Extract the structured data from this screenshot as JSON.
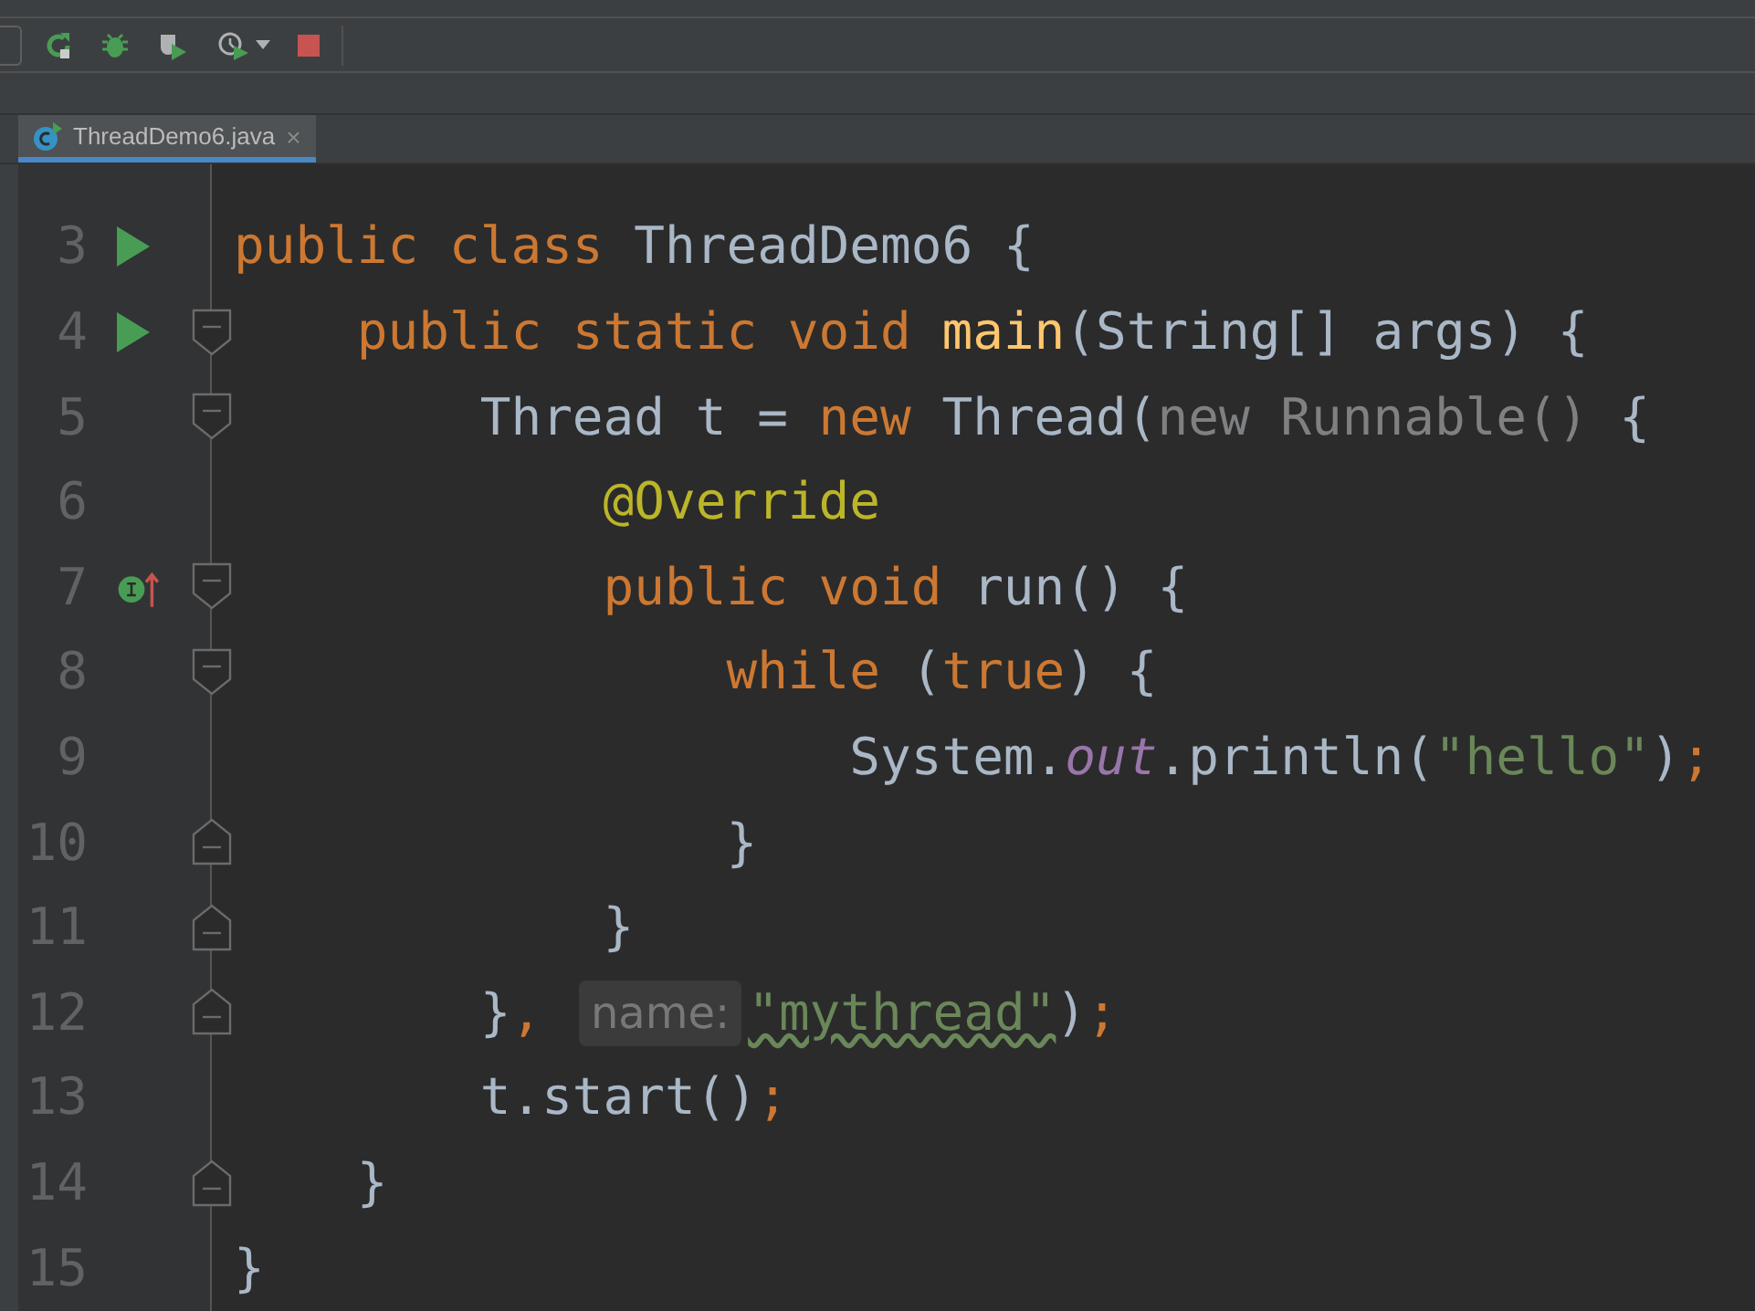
{
  "toolbar": {
    "buttons": [
      {
        "kind": "rerun"
      },
      {
        "kind": "debug"
      },
      {
        "kind": "coverage"
      },
      {
        "kind": "profile"
      },
      {
        "kind": "stop"
      }
    ]
  },
  "tabs": [
    {
      "label": "ThreadDemo6.java",
      "selected": true,
      "close": "×"
    }
  ],
  "editor": {
    "lines": [
      {
        "number": "3",
        "gutter_icon": {
          "kind": "run"
        },
        "tokens": [
          {
            "kind": "keyword",
            "text": "public class "
          },
          {
            "kind": "plain",
            "text": "ThreadDemo6 {"
          }
        ]
      },
      {
        "number": "4",
        "gutter_icon": {
          "kind": "run"
        },
        "fold": {
          "kind": "start"
        },
        "tokens": [
          {
            "kind": "keyword",
            "text": "    public static void "
          },
          {
            "kind": "method",
            "text": "main"
          },
          {
            "kind": "plain",
            "text": "(String[] args) {"
          }
        ]
      },
      {
        "number": "5",
        "fold": {
          "kind": "start"
        },
        "tokens": [
          {
            "kind": "plain",
            "text": "        Thread t = "
          },
          {
            "kind": "keyword",
            "text": "new "
          },
          {
            "kind": "plain",
            "text": "Thread("
          },
          {
            "kind": "dim",
            "text": "new Runnable() "
          },
          {
            "kind": "plain",
            "text": "{"
          }
        ]
      },
      {
        "number": "6",
        "tokens": [
          {
            "kind": "annotation",
            "text": "            @Override"
          }
        ]
      },
      {
        "number": "7",
        "gutter_icon": {
          "kind": "implements"
        },
        "fold": {
          "kind": "start"
        },
        "tokens": [
          {
            "kind": "keyword",
            "text": "            public void "
          },
          {
            "kind": "plain",
            "text": "run() {"
          }
        ]
      },
      {
        "number": "8",
        "fold": {
          "kind": "start"
        },
        "tokens": [
          {
            "kind": "keyword",
            "text": "                while "
          },
          {
            "kind": "plain",
            "text": "("
          },
          {
            "kind": "keyword",
            "text": "true"
          },
          {
            "kind": "plain",
            "text": ") {"
          }
        ]
      },
      {
        "number": "9",
        "tokens": [
          {
            "kind": "plain",
            "text": "                    System."
          },
          {
            "kind": "field",
            "text": "out"
          },
          {
            "kind": "plain",
            "text": ".println("
          },
          {
            "kind": "string",
            "text": "\"hello\""
          },
          {
            "kind": "plain",
            "text": ")"
          },
          {
            "kind": "keyword",
            "text": ";"
          }
        ]
      },
      {
        "number": "10",
        "fold": {
          "kind": "end"
        },
        "tokens": [
          {
            "kind": "plain",
            "text": "                }"
          }
        ]
      },
      {
        "number": "11",
        "fold": {
          "kind": "end"
        },
        "tokens": [
          {
            "kind": "plain",
            "text": "            }"
          }
        ]
      },
      {
        "number": "12",
        "fold": {
          "kind": "end"
        },
        "tokens": [
          {
            "kind": "plain",
            "text": "        }"
          },
          {
            "kind": "keyword",
            "text": ", "
          },
          {
            "kind": "hint",
            "text": "name:"
          },
          {
            "kind": "warning_string",
            "text": "\"mythread\""
          },
          {
            "kind": "plain",
            "text": ")"
          },
          {
            "kind": "keyword",
            "text": ";"
          }
        ]
      },
      {
        "number": "13",
        "tokens": [
          {
            "kind": "plain",
            "text": "        t.start()"
          },
          {
            "kind": "keyword",
            "text": ";"
          }
        ]
      },
      {
        "number": "14",
        "fold": {
          "kind": "end"
        },
        "tokens": [
          {
            "kind": "plain",
            "text": "    }"
          }
        ]
      },
      {
        "number": "15",
        "tokens": [
          {
            "kind": "plain",
            "text": "}"
          }
        ]
      }
    ]
  }
}
